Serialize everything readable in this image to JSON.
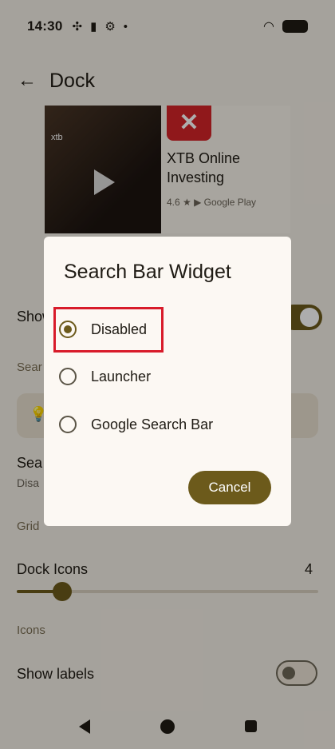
{
  "status": {
    "time": "14:30"
  },
  "appbar": {
    "title": "Dock"
  },
  "ad": {
    "video_logo": "xtb",
    "app_name": "XTB Online Investing",
    "rating": "4.6 ★ ▶ Google Play"
  },
  "settings": {
    "show_row": "Show",
    "cat_search": "Sear",
    "search_title": "Sea",
    "search_sub": "Disa",
    "cat_grid": "Grid",
    "dock_icons": {
      "label": "Dock Icons",
      "value": "4",
      "fraction": 0.15
    },
    "cat_icons": "Icons",
    "show_labels": "Show labels"
  },
  "dialog": {
    "title": "Search Bar Widget",
    "options": [
      {
        "label": "Disabled",
        "selected": true
      },
      {
        "label": "Launcher",
        "selected": false
      },
      {
        "label": "Google Search Bar",
        "selected": false
      }
    ],
    "cancel": "Cancel"
  },
  "colors": {
    "accent": "#6c5a1b",
    "highlight": "#d81b2a"
  }
}
